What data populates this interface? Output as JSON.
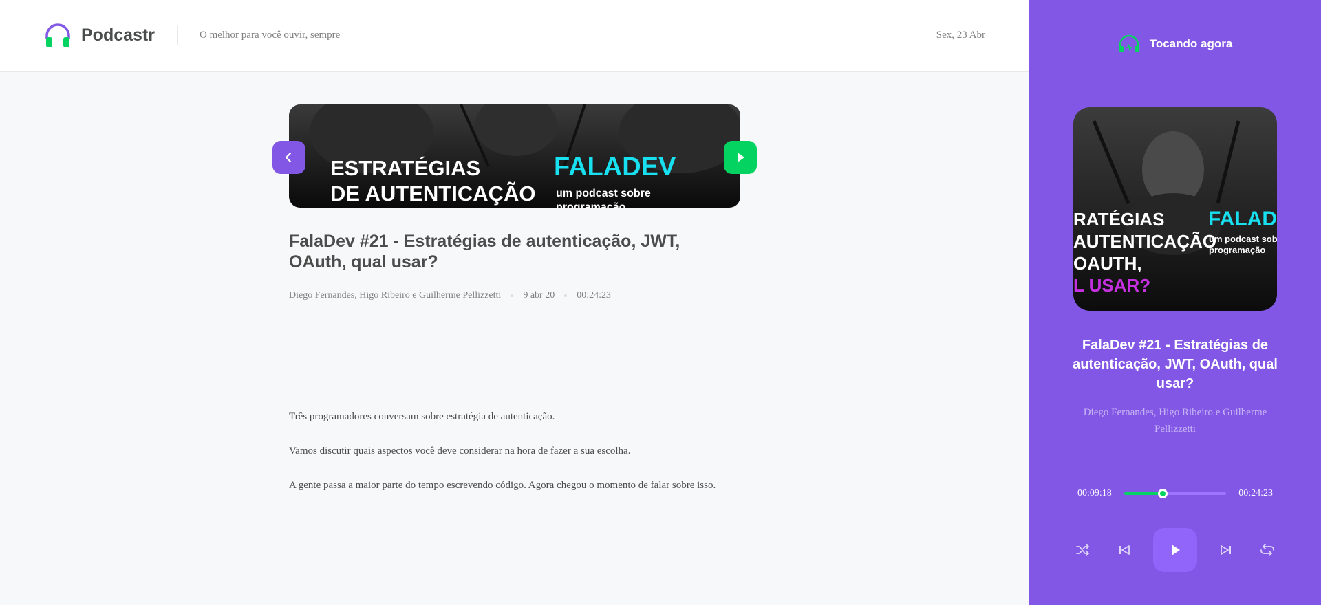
{
  "header": {
    "brand": "Podcastr",
    "tagline": "O melhor para você ouvir, sempre",
    "date": "Sex, 23 Abr"
  },
  "episode": {
    "thumbnail_text": {
      "line1": "ESTRATÉGIAS",
      "line2": "DE AUTENTICAÇÃO",
      "brand": "FALADEV",
      "sub1": "um podcast sobre",
      "sub2": "programação"
    },
    "title": "FalaDev #21 - Estratégias de autenticação, JWT, OAuth, qual usar?",
    "members": "Diego Fernandes, Higo Ribeiro e Guilherme Pellizzetti",
    "published_at": "9 abr 20",
    "duration": "00:24:23",
    "description": [
      "Três programadores conversam sobre estratégia de autenticação.",
      "Vamos discutir quais aspectos você deve considerar na hora de fazer a sua escolha.",
      "A gente passa a maior parte do tempo escrevendo código. Agora chegou o momento de falar sobre isso."
    ]
  },
  "player": {
    "header_label": "Tocando agora",
    "cover_text": {
      "line1": "RATÉGIAS",
      "line2": "AUTENTICAÇÃO",
      "line3": "OAUTH,",
      "line4": "L USAR?",
      "brand": "FALAD",
      "sub1": "um podcast sobr",
      "sub2": "programação"
    },
    "title": "FalaDev #21 - Estratégias de autenticação, JWT, OAuth, qual usar?",
    "members": "Diego Fernandes, Higo Ribeiro e Guilherme Pellizzetti",
    "current_time": "00:09:18",
    "total_time": "00:24:23",
    "progress_fraction": 0.38
  },
  "icons": {
    "back": "chevron-left-icon",
    "play": "play-icon",
    "shuffle": "shuffle-icon",
    "previous": "skip-previous-icon",
    "next": "skip-next-icon",
    "repeat": "repeat-icon",
    "now_playing": "headphones-icon"
  },
  "colors": {
    "accent": "#8257e5",
    "green": "#04d361",
    "text": "#494d4b",
    "muted": "#808080"
  }
}
